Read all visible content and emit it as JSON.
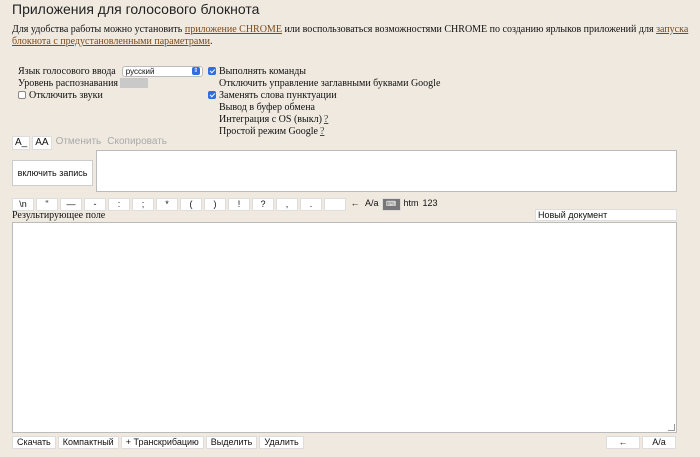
{
  "header": {
    "title": "Приложения для голосового блокнота"
  },
  "intro": {
    "text_before": "Для удобства работы можно установить ",
    "link1": "приложение CHROME",
    "text_middle": " или воспользоваться возможностями CHROME по созданию ярлыков приложений для ",
    "link2": "запуска блокнота с предустановленными параметрами",
    "text_after": "."
  },
  "settings": {
    "lang_label": "Язык голосового ввода",
    "lang_value": "русский",
    "level_label": "Уровень распознавания",
    "mute_label": "Отключить звуки"
  },
  "options": [
    {
      "label": "Выполнять команды",
      "checked": true,
      "has_checkbox": true,
      "help": ""
    },
    {
      "label": "Отключить управление заглавными буквами Google",
      "checked": false,
      "has_checkbox": false,
      "help": ""
    },
    {
      "label": "Заменять слова пунктуации",
      "checked": true,
      "has_checkbox": true,
      "help": ""
    },
    {
      "label": "Вывод в буфер обмена",
      "checked": false,
      "has_checkbox": false,
      "help": ""
    },
    {
      "label": "Интеграция с OS (выкл)",
      "checked": false,
      "has_checkbox": false,
      "help": "?"
    },
    {
      "label": "Простой режим Google",
      "checked": false,
      "has_checkbox": false,
      "help": "?"
    }
  ],
  "format_toolbar": {
    "underline": "A_",
    "case": "AA",
    "undo": "Отменить",
    "copy": "Скопировать"
  },
  "record": {
    "label": "включить запись"
  },
  "punctuation": [
    "\\n",
    "\"",
    "—",
    "-",
    ":",
    ";",
    "*",
    "(",
    ")",
    "!",
    "?",
    ",",
    "."
  ],
  "punct_extras": {
    "backspace": "←",
    "case_toggle": "A/a",
    "keyboard": "⌨",
    "htm": "htm",
    "digits": "123"
  },
  "result": {
    "label": "Результирующее поле",
    "document_name": "Новый документ"
  },
  "bottom": {
    "download": "Скачать",
    "compact": "Компактный",
    "transcribe": "+ Транскрибацию",
    "select": "Выделить",
    "delete": "Удалить",
    "back": "←",
    "case": "A/a"
  },
  "colors": {
    "background": "#efe9e0",
    "link": "#7a4a1a",
    "checkbox": "#2f6fdd"
  }
}
